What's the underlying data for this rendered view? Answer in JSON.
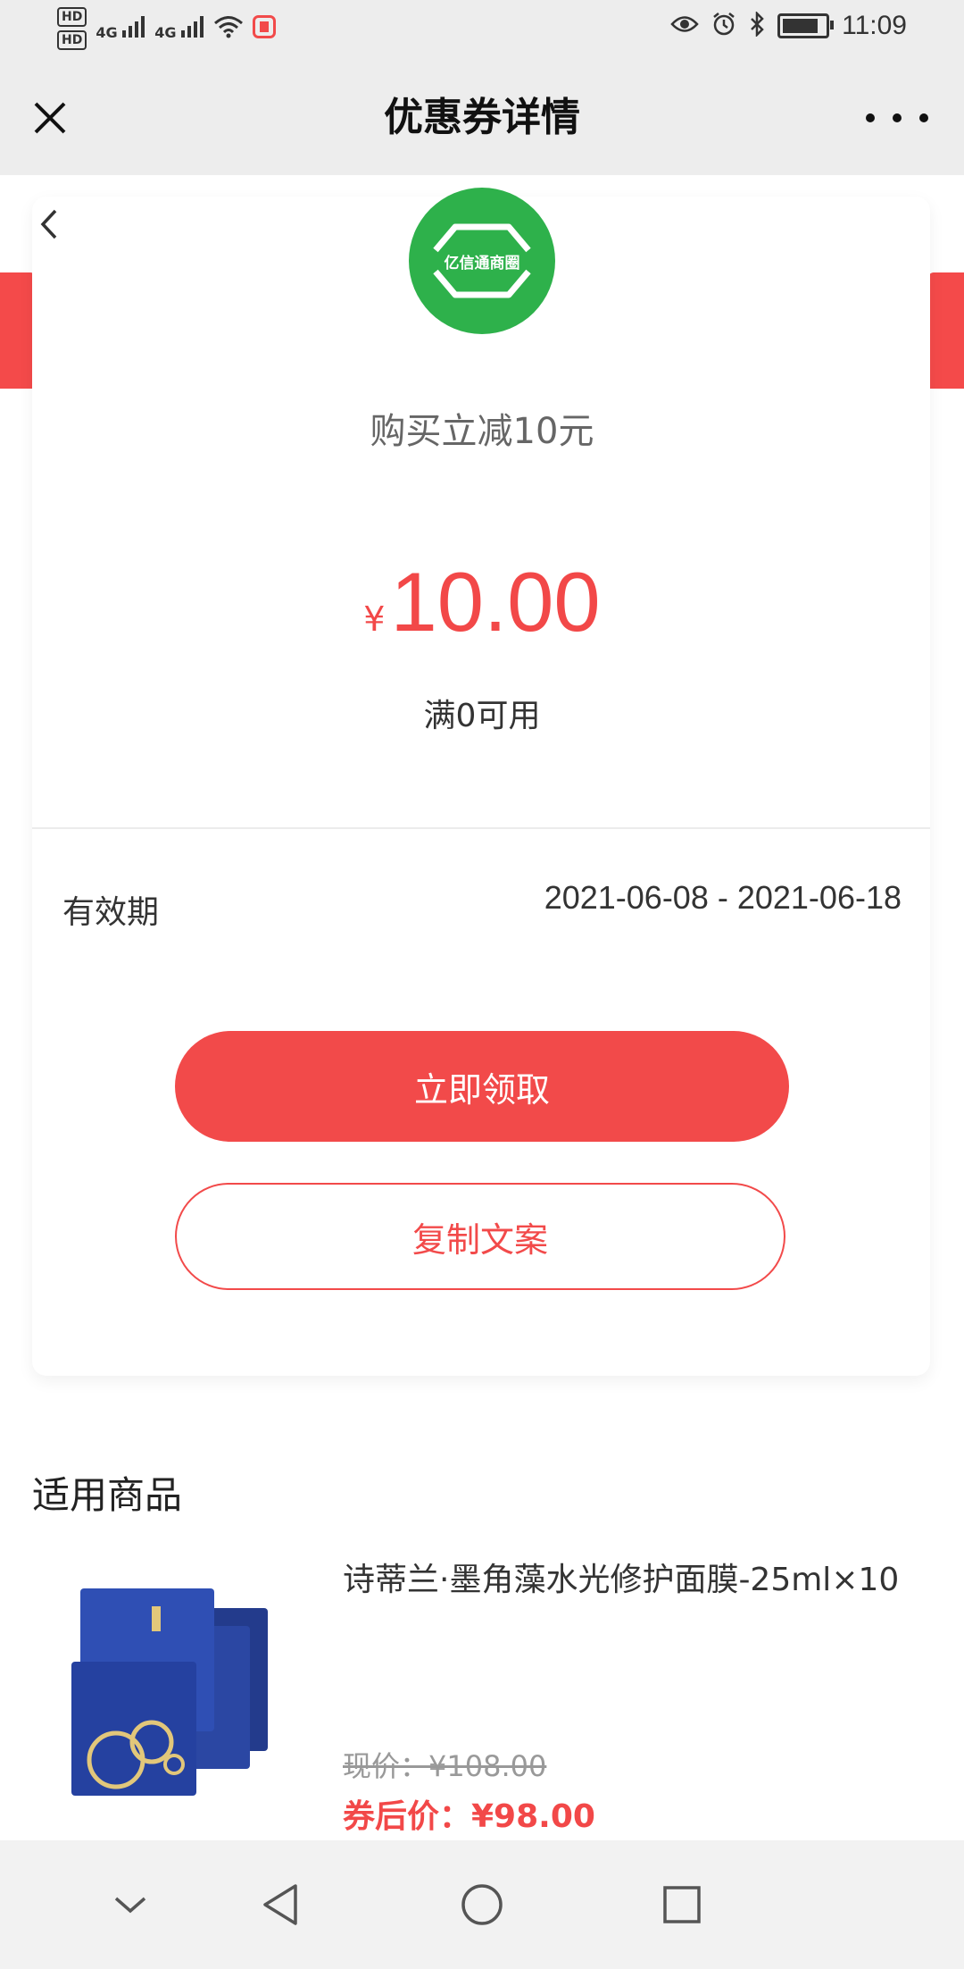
{
  "status_bar": {
    "hd1": "HD",
    "hd2": "HD",
    "net1": "4G",
    "net2": "4G",
    "time": "11:09",
    "battery_level": 0.85
  },
  "nav": {
    "title": "优惠券详情"
  },
  "coupon": {
    "logo_text": "亿信通商圈",
    "title": "购买立减10元",
    "currency": "¥",
    "amount": "10.00",
    "threshold": "满0可用",
    "validity_label": "有效期",
    "validity_value": "2021-06-08 - 2021-06-18",
    "claim_button": "立即领取",
    "copy_button": "复制文案"
  },
  "products_section": {
    "title": "适用商品",
    "items": [
      {
        "name": "诗蒂兰·墨角藻水光修护面膜-25ml×10",
        "current_price": "现价：¥108.00",
        "after_coupon_price": "券后价：¥98.00"
      }
    ]
  },
  "colors": {
    "accent": "#f24a4a",
    "logo": "#2eb14b"
  }
}
